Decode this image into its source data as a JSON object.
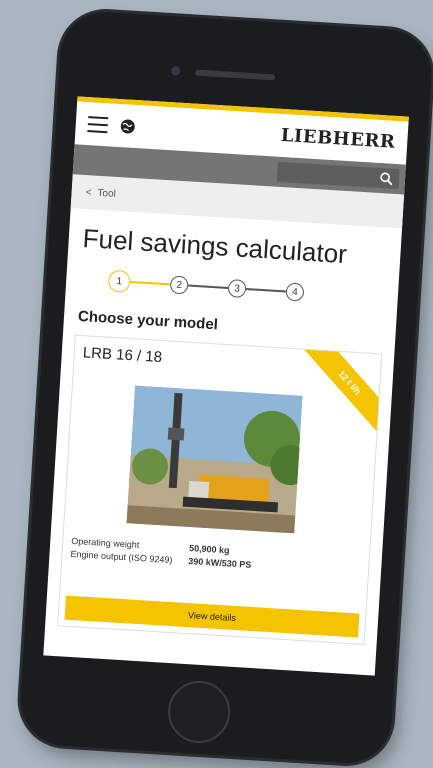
{
  "header": {
    "logo": "LIEBHERR"
  },
  "breadcrumb": {
    "chevron": "<",
    "label": "Tool"
  },
  "page": {
    "title": "Fuel savings calculator",
    "subtitle": "Choose your model"
  },
  "steps": [
    "1",
    "2",
    "3",
    "4"
  ],
  "card": {
    "model": "LRB 16 / 18",
    "ribbon": "12 t l/h",
    "specs": [
      {
        "label": "Operating weight",
        "value": "50,900 kg"
      },
      {
        "label": "Engine output (ISO 9249)",
        "value": "390 kW/530 PS"
      }
    ],
    "button": "View details"
  },
  "colors": {
    "accent": "#f5c400",
    "searchbar": "#757574",
    "breadcrumb_bg": "#eeeeee"
  },
  "icons": [
    "menu-icon",
    "globe-icon",
    "search-icon",
    "chevron-left-icon"
  ]
}
